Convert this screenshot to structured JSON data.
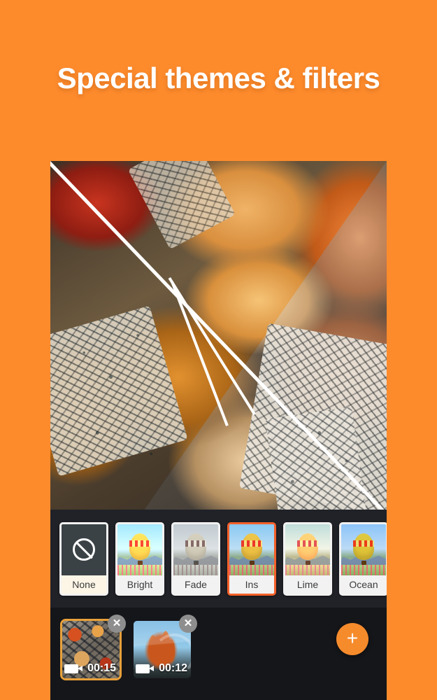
{
  "promo": {
    "title": "Special themes & filters",
    "background_color": "#FD8B2C",
    "title_color": "#FFFFFF"
  },
  "preview": {
    "name": "filter-preview-split",
    "description": "Food photo split diagonally showing filtered vs original"
  },
  "filter_strip": {
    "selected": "Ins",
    "accent_color": "#F4602A",
    "chips": [
      {
        "label": "None",
        "icon": "no-filter-icon",
        "selected": false
      },
      {
        "label": "Bright",
        "icon": "balloon-thumb",
        "selected": false
      },
      {
        "label": "Fade",
        "icon": "balloon-thumb",
        "selected": false
      },
      {
        "label": "Ins",
        "icon": "balloon-thumb",
        "selected": true
      },
      {
        "label": "Lime",
        "icon": "balloon-thumb",
        "selected": false
      },
      {
        "label": "Ocean",
        "icon": "balloon-thumb",
        "selected": false
      }
    ]
  },
  "timeline": {
    "clips": [
      {
        "duration": "00:15",
        "selected": true,
        "close_icon": "close-icon",
        "media_icon": "video-camera-icon"
      },
      {
        "duration": "00:12",
        "selected": false,
        "close_icon": "close-icon",
        "media_icon": "video-camera-icon"
      }
    ],
    "add_button": {
      "label": "+",
      "icon": "plus-icon",
      "color": "#F68B2C"
    }
  }
}
